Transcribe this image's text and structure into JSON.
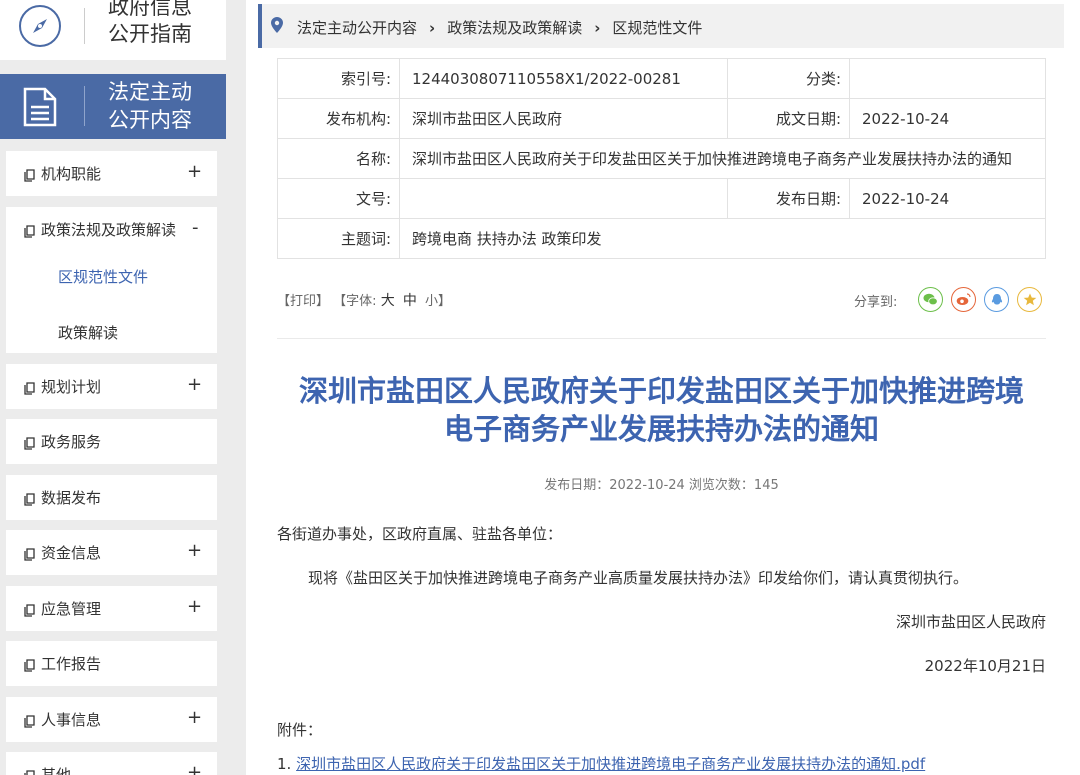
{
  "sidebar": {
    "guide": {
      "line1": "政府信息",
      "line2": "公开指南"
    },
    "active": {
      "line1": "法定主动",
      "line2": "公开内容"
    },
    "items": [
      {
        "label": "机构职能",
        "toggle": "+"
      },
      {
        "label": "政策法规及政策解读",
        "toggle": "-"
      },
      {
        "label": "规划计划",
        "toggle": "+"
      },
      {
        "label": "政务服务",
        "toggle": ""
      },
      {
        "label": "数据发布",
        "toggle": ""
      },
      {
        "label": "资金信息",
        "toggle": "+"
      },
      {
        "label": "应急管理",
        "toggle": "+"
      },
      {
        "label": "工作报告",
        "toggle": ""
      },
      {
        "label": "人事信息",
        "toggle": "+"
      },
      {
        "label": "其他",
        "toggle": "+"
      }
    ],
    "subitems": [
      {
        "label": "区规范性文件"
      },
      {
        "label": "政策解读"
      }
    ]
  },
  "breadcrumb": [
    "法定主动公开内容",
    "政策法规及政策解读",
    "区规范性文件"
  ],
  "meta": {
    "index_label": "索引号:",
    "index_value": "1244030807110558X1/2022-00281",
    "category_label": "分类:",
    "category_value": "",
    "publisher_label": "发布机构:",
    "publisher_value": "深圳市盐田区人民政府",
    "created_label": "成文日期:",
    "created_value": "2022-10-24",
    "name_label": "名称:",
    "name_value": "深圳市盐田区人民政府关于印发盐田区关于加快推进跨境电子商务产业发展扶持办法的通知",
    "docno_label": "文号:",
    "docno_value": "",
    "pubdate_label": "发布日期:",
    "pubdate_value": "2022-10-24",
    "topic_label": "主题词:",
    "topic_value": "跨境电商 扶持办法 政策印发"
  },
  "toolbar": {
    "print": "【打印】",
    "font_open": "【字体:",
    "font_large": "大",
    "font_medium": "中",
    "font_small": "小】",
    "share_label": "分享到:"
  },
  "share_icons": [
    "wechat-icon",
    "weibo-icon",
    "qq-icon",
    "qzone-icon"
  ],
  "article": {
    "title_line1": "深圳市盐田区人民政府关于印发盐田区关于加快推进跨境",
    "title_line2": "电子商务产业发展扶持办法的通知",
    "pubinfo": "发布日期：2022-10-24  浏览次数：145",
    "greeting": "各街道办事处，区政府直属、驻盐各单位：",
    "paragraph": "现将《盐田区关于加快推进跨境电子商务产业高质量发展扶持办法》印发给你们，请认真贯彻执行。",
    "signature": "深圳市盐田区人民政府",
    "date": "2022年10月21日",
    "attachment_label": "附件：",
    "attachment_index": "1.",
    "attachment_link": "深圳市盐田区人民政府关于印发盐田区关于加快推进跨境电子商务产业发展扶持办法的通知.pdf"
  },
  "colors": {
    "accent": "#4a6aa5",
    "title": "#3d64b0",
    "background": "#ececec"
  }
}
